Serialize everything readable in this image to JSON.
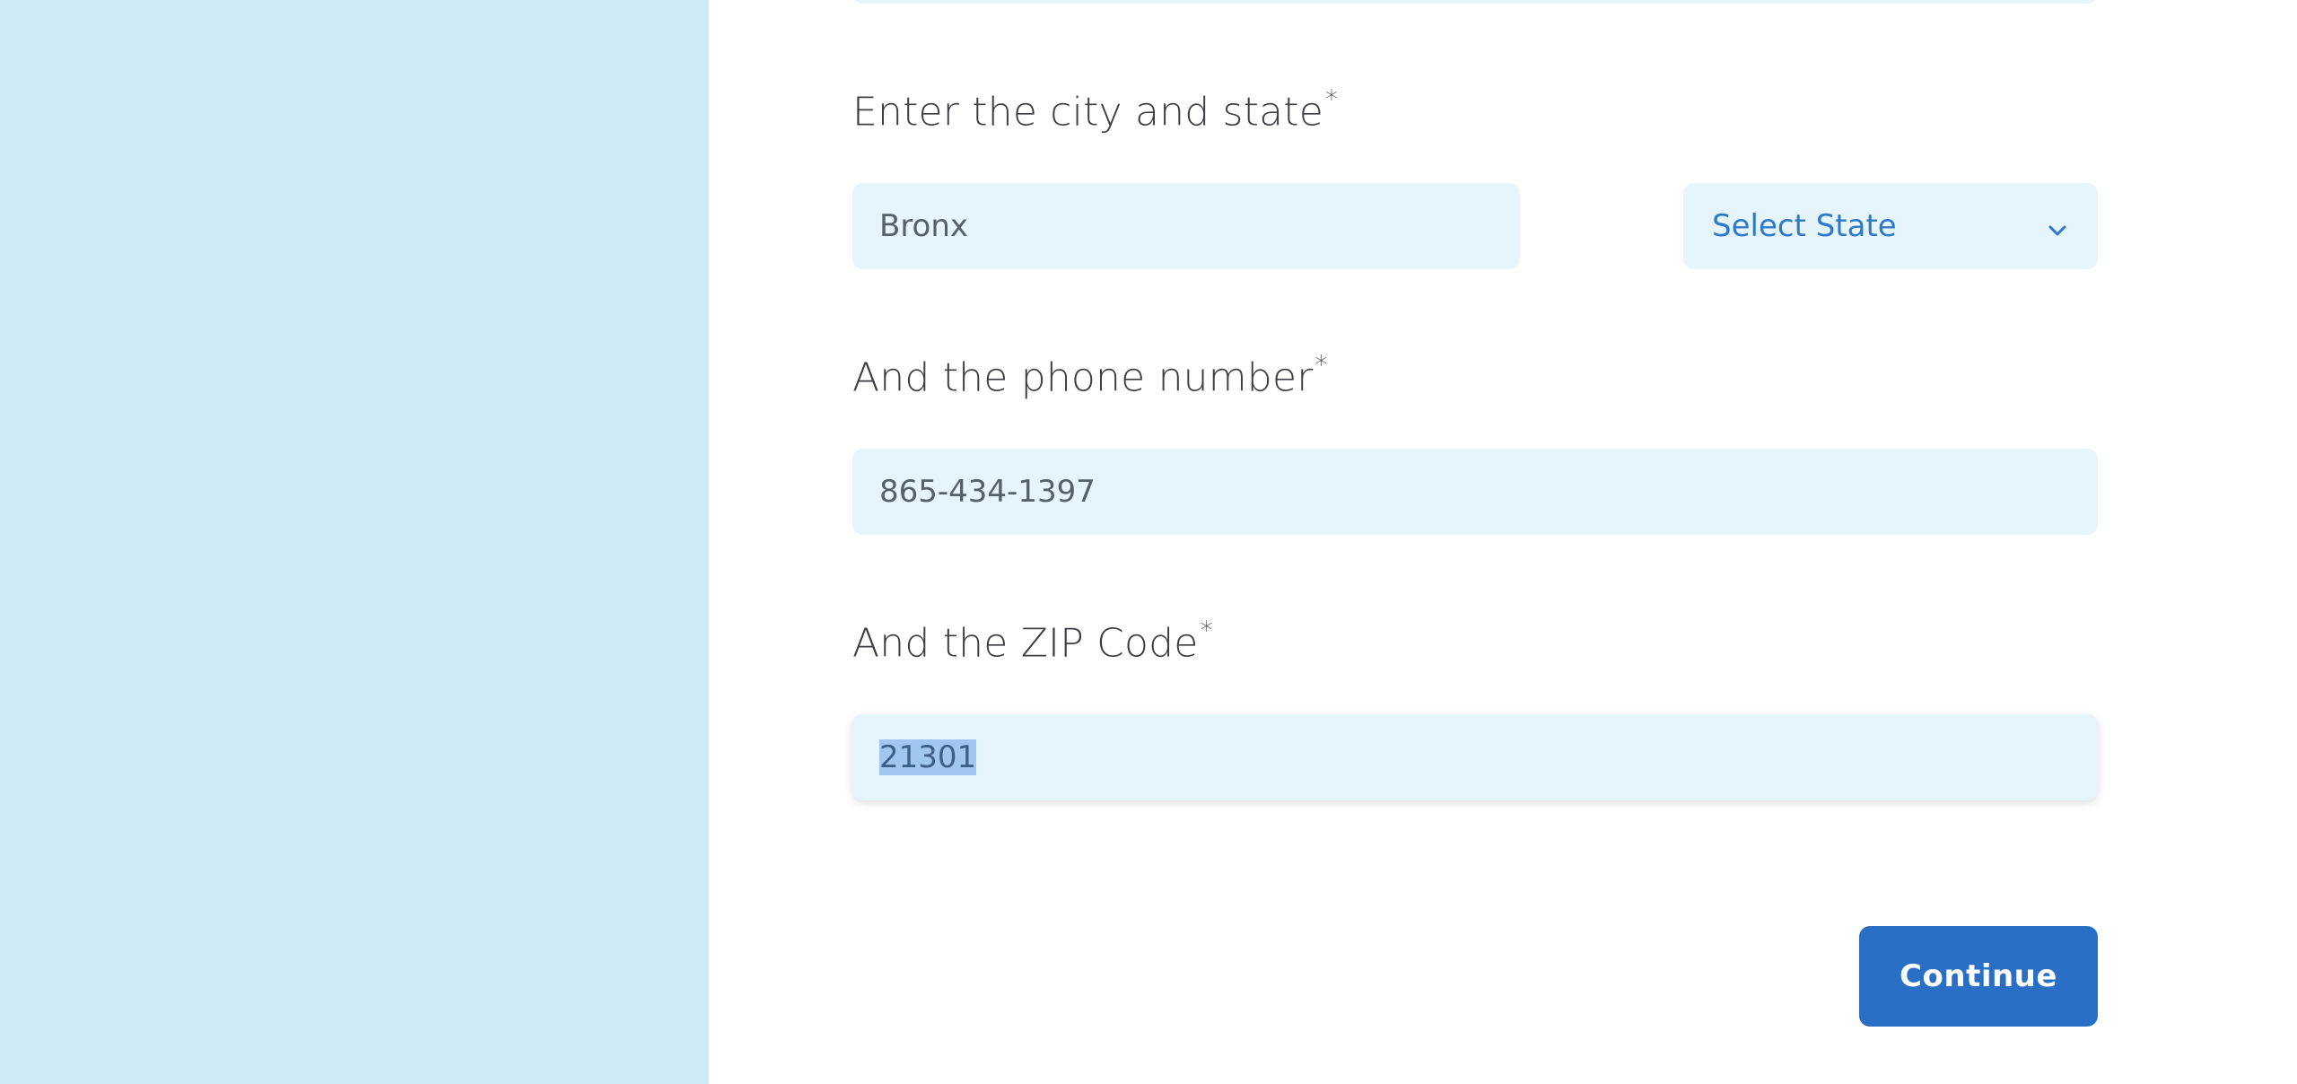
{
  "city_state": {
    "question": "Enter the city and state",
    "required_mark": "*",
    "city_value": "Bronx",
    "state_select": {
      "selected": "Select State",
      "icon": "chevron-down-icon"
    }
  },
  "phone": {
    "question": "And the phone number",
    "required_mark": "*",
    "value": "865-434-1397"
  },
  "zip": {
    "question": "And the ZIP Code",
    "required_mark": "*",
    "value": "21301"
  },
  "actions": {
    "continue_label": "Continue"
  },
  "colors": {
    "left_panel": "#cfebf6",
    "field_bg": "#e6f4fb",
    "accent": "#2a6fc6",
    "select_text": "#2f7ac8"
  }
}
